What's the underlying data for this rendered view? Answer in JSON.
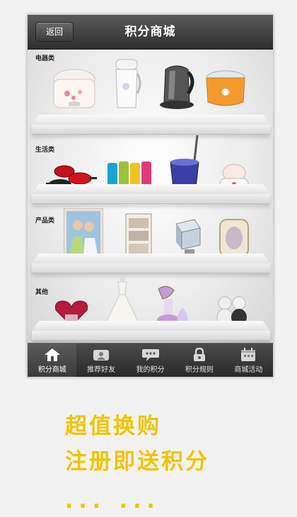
{
  "navbar": {
    "back_label": "返回",
    "title": "积分商城"
  },
  "categories": [
    {
      "label": "电器类",
      "items": [
        "rice-cooker",
        "soymilk-maker",
        "electric-kettle",
        "yogurt-maker"
      ]
    },
    {
      "label": "生活类",
      "items": [
        "cookware-set",
        "luggage-set",
        "spin-mop-bucket",
        "egg-cooker"
      ]
    },
    {
      "label": "产品类",
      "items": [
        "photo-frame-couple",
        "photo-stand",
        "photo-cube",
        "ornate-frame"
      ]
    },
    {
      "label": "其他",
      "items": [
        "heart-jewelry-box",
        "wedding-dress",
        "facial-steamer",
        "teddy-bear-couple"
      ]
    }
  ],
  "tabbar": {
    "tabs": [
      {
        "label": "积分商城",
        "icon": "home-icon",
        "active": true
      },
      {
        "label": "推荐好友",
        "icon": "friends-icon",
        "active": false
      },
      {
        "label": "我的积分",
        "icon": "chat-icon",
        "active": false
      },
      {
        "label": "积分规则",
        "icon": "lock-icon",
        "active": false
      },
      {
        "label": "商城活动",
        "icon": "calendar-icon",
        "active": false
      }
    ]
  },
  "promo": {
    "line1": "超值换购",
    "line2": "注册即送积分",
    "dots": "... ..."
  },
  "colors": {
    "accent": "#f0c400",
    "navbar": "#3a3a3a"
  }
}
